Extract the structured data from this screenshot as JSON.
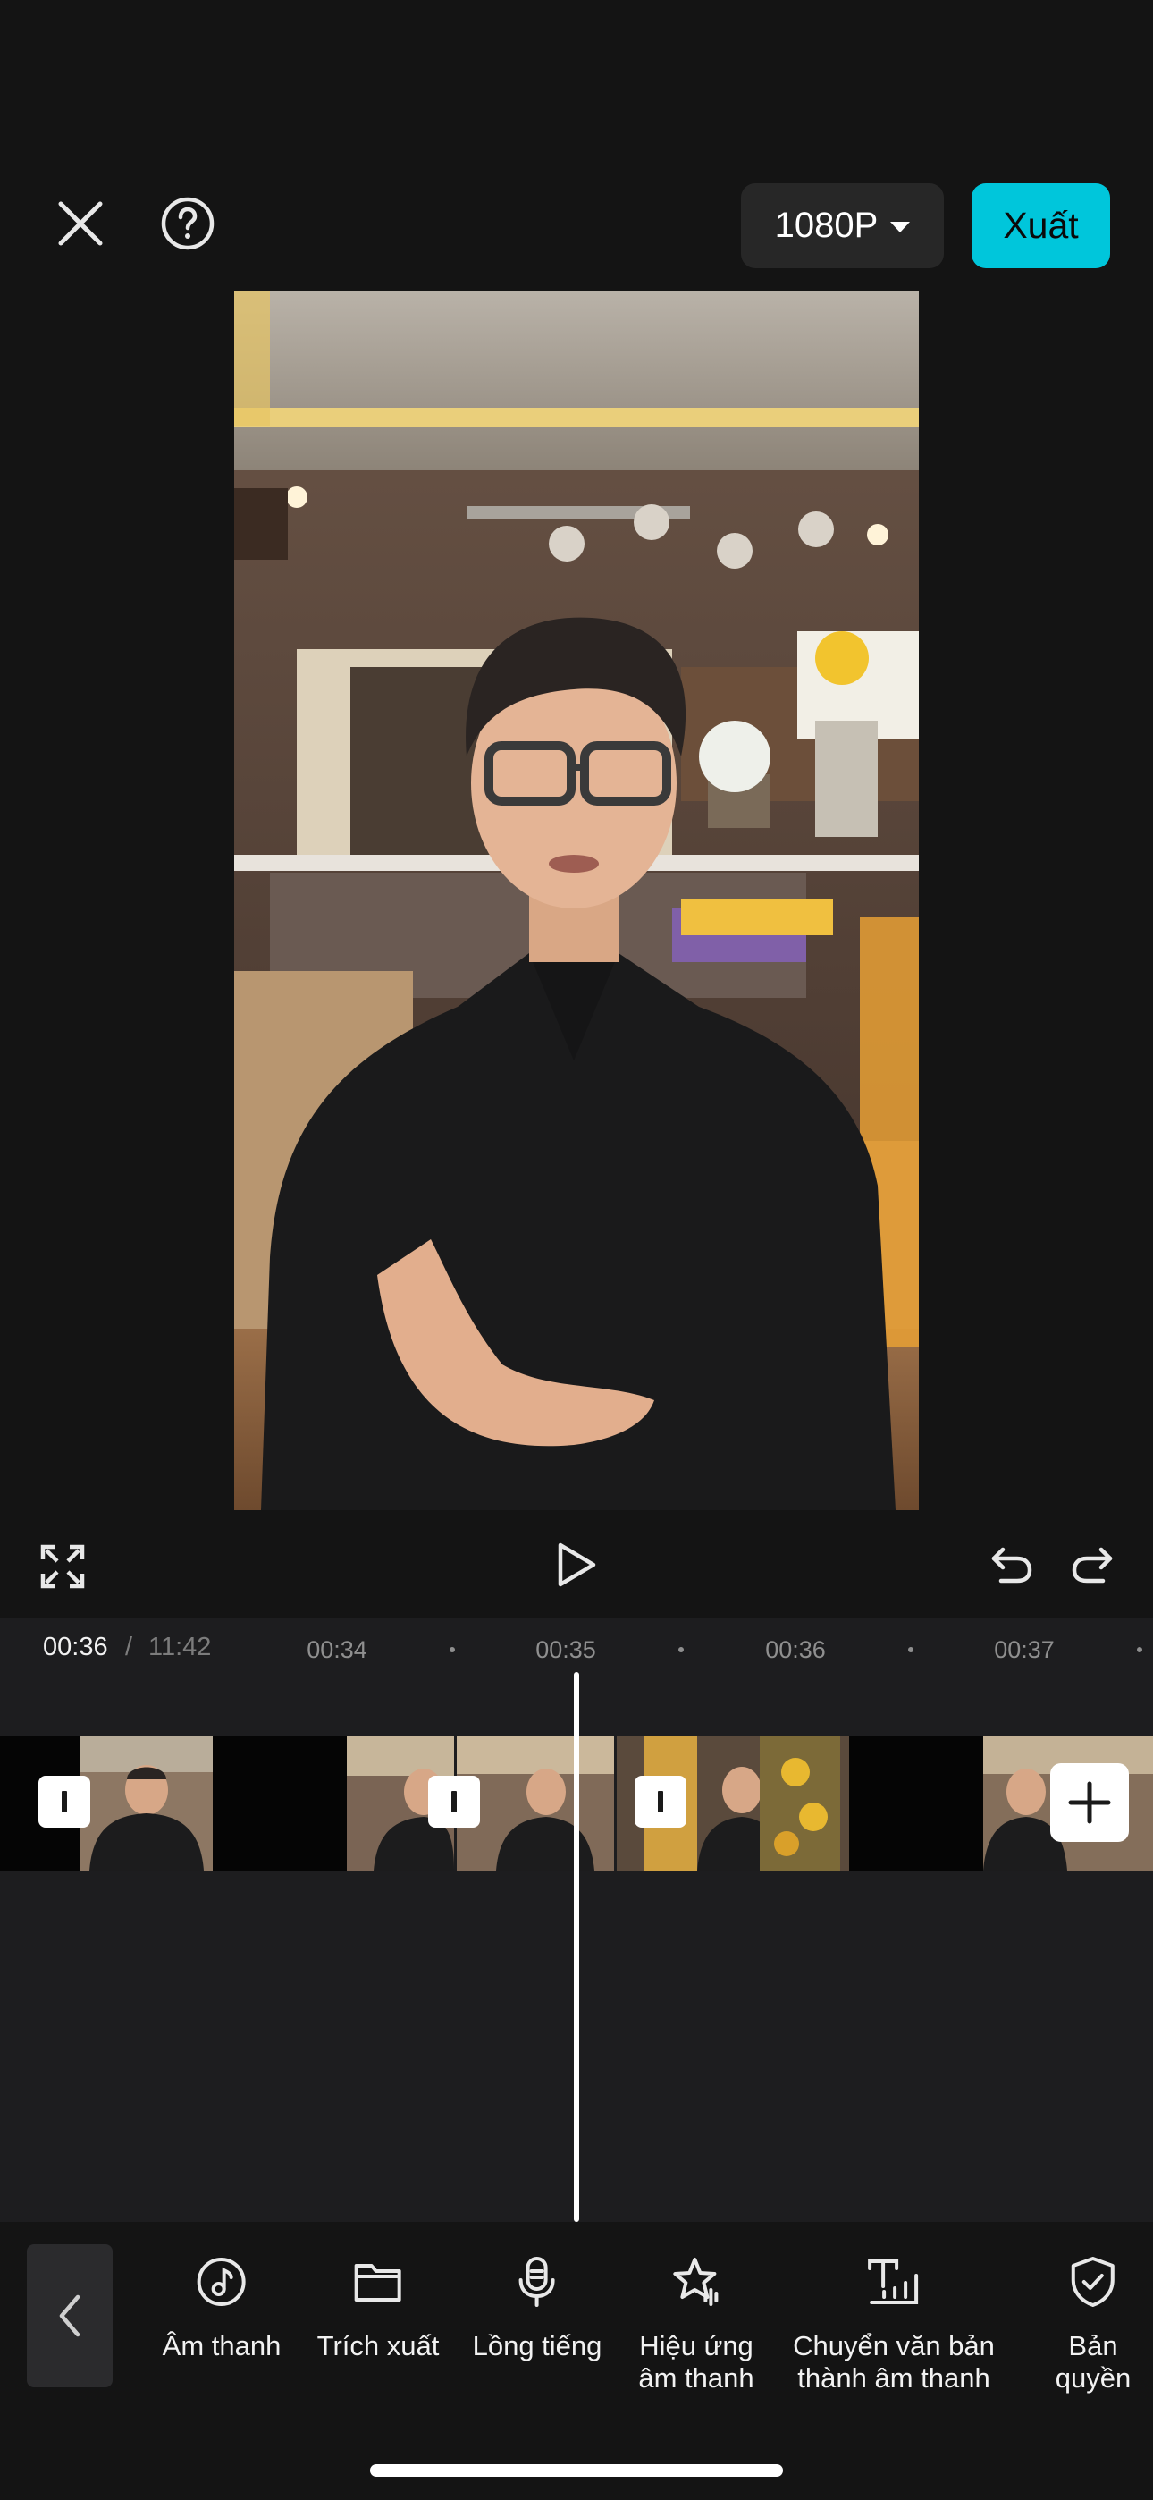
{
  "header": {
    "resolution_label": "1080P",
    "export_label": "Xuất"
  },
  "player": {
    "current_time": "00:36",
    "separator": "/",
    "total_time": "11:42"
  },
  "timeline": {
    "ticks": [
      "00:34",
      "00:35",
      "00:36",
      "00:37"
    ]
  },
  "toolbar": {
    "items": [
      {
        "label": "Âm thanh",
        "icon": "music-note-icon"
      },
      {
        "label": "Trích xuất",
        "icon": "folder-icon"
      },
      {
        "label": "Lồng tiếng",
        "icon": "microphone-icon"
      },
      {
        "label": "Hiệu ứng\nâm thanh",
        "icon": "star-sound-icon"
      },
      {
        "label": "Chuyển văn bản\nthành âm thanh",
        "icon": "text-to-speech-icon"
      },
      {
        "label": "Bản quyền",
        "icon": "shield-check-icon"
      }
    ]
  },
  "colors": {
    "accent": "#00c6db",
    "background": "#141414",
    "timeline_bg": "#1d1d1f"
  }
}
